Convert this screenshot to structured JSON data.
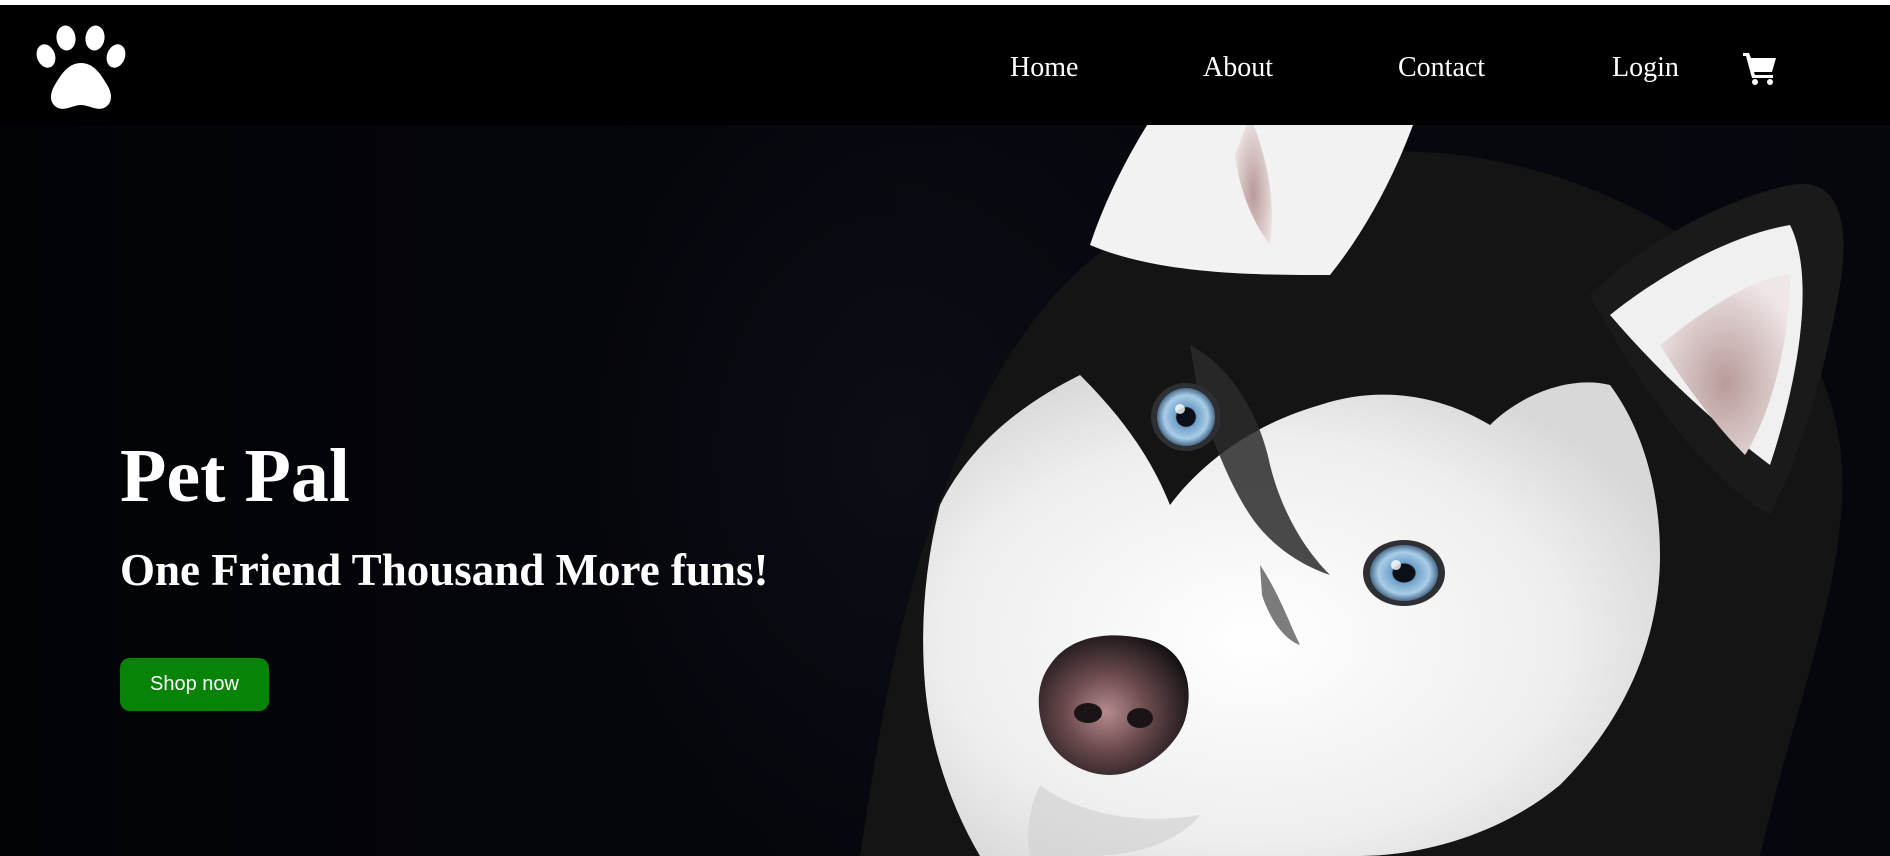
{
  "navbar": {
    "logo_icon": "paw-icon",
    "links": [
      {
        "label": "Home"
      },
      {
        "label": "About"
      },
      {
        "label": "Contact"
      },
      {
        "label": "Login"
      }
    ],
    "cart_icon": "shopping-cart-icon"
  },
  "hero": {
    "title": "Pet Pal",
    "tagline": "One Friend Thousand More funs!",
    "button_label": "Shop now",
    "image_icon": "husky-dog-photo"
  },
  "colors": {
    "navbar_background": "#000000",
    "hero_background": "#05060c",
    "text": "#ffffff",
    "button_background": "#078307",
    "dog_eye": "#a9cde8"
  }
}
